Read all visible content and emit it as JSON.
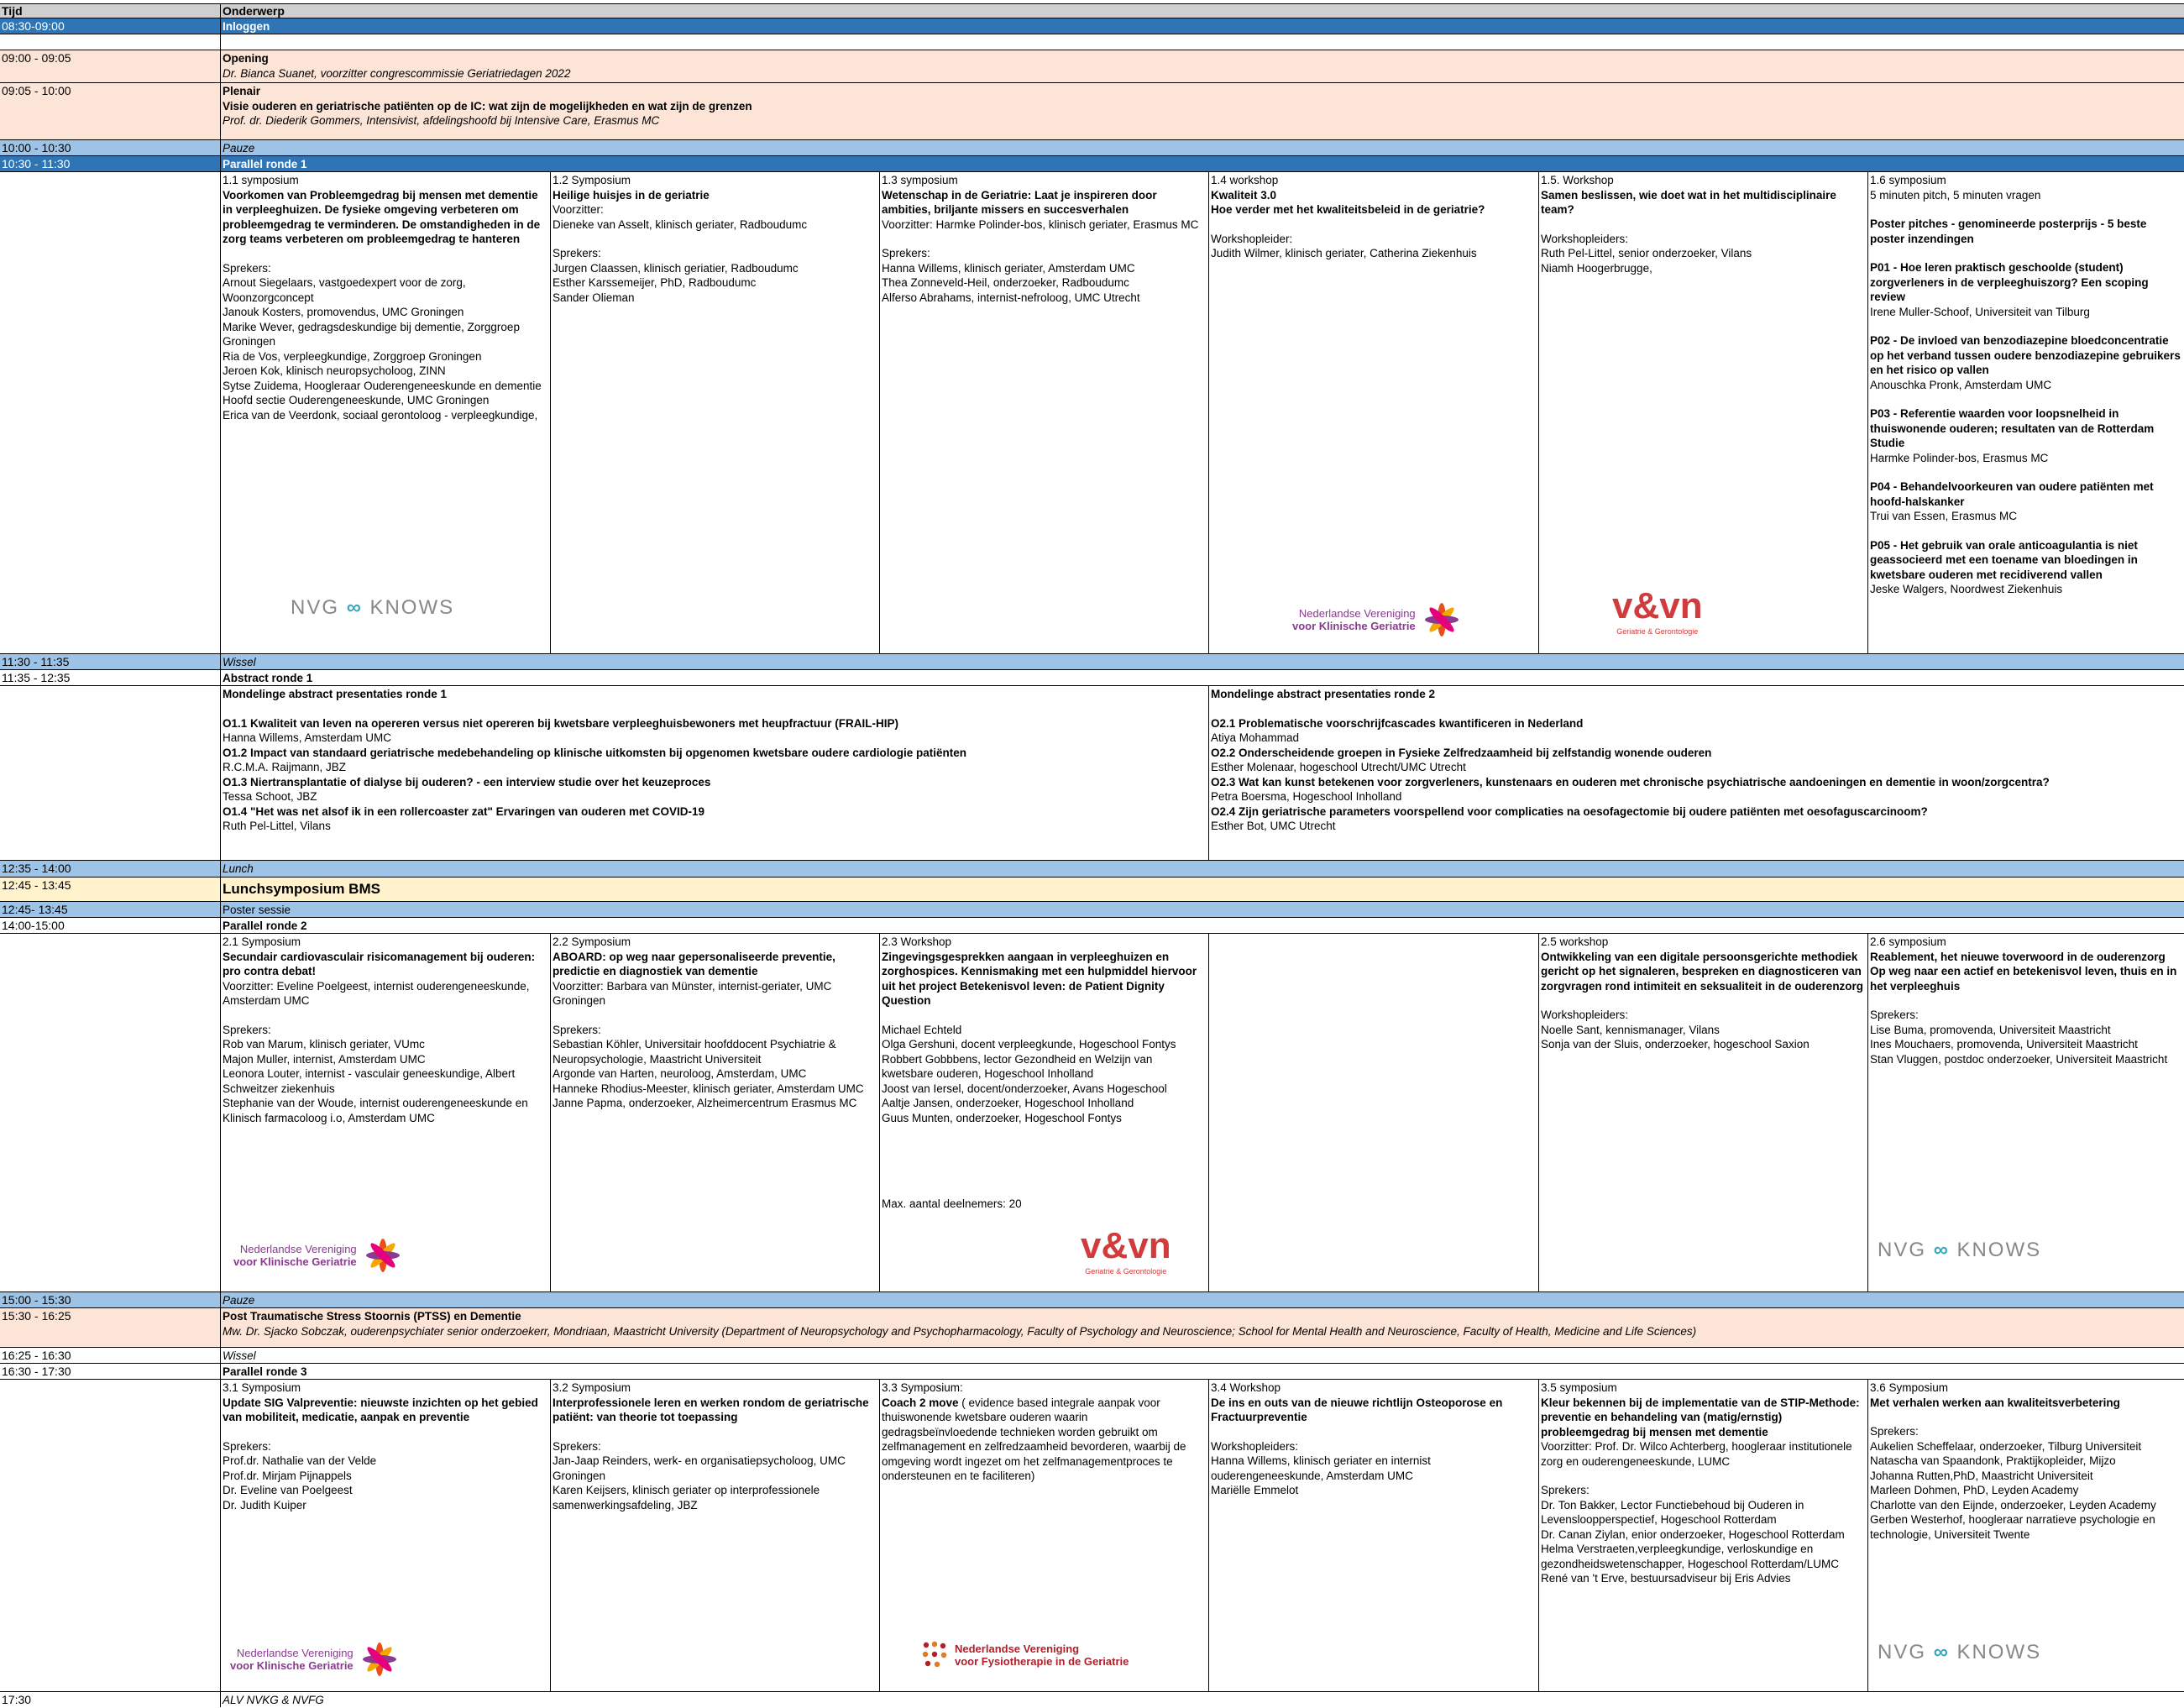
{
  "header": {
    "time": "Tijd",
    "subject": "Onderwerp"
  },
  "rows": {
    "r1": {
      "time": "08:30-09:00",
      "title": "Inloggen"
    },
    "r2": {
      "time": "09:00 - 09:05",
      "title": "Opening",
      "sub": "Dr. Bianca Suanet, voorzitter congrescommissie Geriatriedagen  2022"
    },
    "r3": {
      "time": "09:05 - 10:00",
      "label": "Plenair",
      "title": "Visie ouderen en geriatrische patiënten op de IC: wat zijn de mogelijkheden en wat zijn de grenzen",
      "sub": "Prof. dr. Diederik Gommers, Intensivist, afdelingshoofd bij Intensive Care, Erasmus MC"
    },
    "r4": {
      "time": "10:00 - 10:30",
      "title": "Pauze"
    },
    "r5": {
      "time": "10:30 - 11:30",
      "title": "Parallel ronde 1"
    },
    "r6": {
      "time": "11:30 - 11:35",
      "title": "Wissel"
    },
    "r7": {
      "time": "11:35 - 12:35",
      "title": "Abstract ronde 1"
    },
    "r8": {
      "time": "12:35 - 14:00",
      "title": "Lunch"
    },
    "r9": {
      "time": "12:45 - 13:45",
      "title": "Lunchsymposium BMS"
    },
    "r10": {
      "time": "12:45- 13:45",
      "title": "Poster sessie"
    },
    "r11": {
      "time": "14:00-15:00",
      "title": "Parallel ronde 2"
    },
    "r12": {
      "time": "15:00 - 15:30",
      "title": "Pauze"
    },
    "r13": {
      "time": "15:30 - 16:25",
      "title": "Post Traumatische Stress Stoornis (PTSS) en Dementie",
      "sub": "Mw. Dr. Sjacko Sobczak, ouderenpsychiater senior onderzoekerr, Mondriaan, Maastricht University (Department of Neuropsychology and Psychopharmacology, Faculty of Psychology and Neuroscience; School for Mental Health and Neuroscience, Faculty of Health, Medicine and Life Sciences)"
    },
    "r14": {
      "time": "16:25 - 16:30",
      "title": "Wissel"
    },
    "r15": {
      "time": "16:30 - 17:30",
      "title": "Parallel ronde 3"
    },
    "r16": {
      "time": "17:30",
      "title": "ALV NVKG & NVFG"
    }
  },
  "round1": {
    "s1": {
      "type": "1.1 symposium",
      "title": "Voorkomen van Probleemgedrag bij mensen met dementie in verpleeghuizen. De fysieke omgeving verbeteren om probleemgedrag te verminderen. De omstandigheden in de zorg teams verbeteren om probleemgedrag te hanteren",
      "spk_label": "Sprekers:",
      "people": [
        "Arnout Siegelaars, vastgoedexpert voor de zorg, Woonzorgconcept",
        "Janouk Kosters, promovendus, UMC Groningen",
        "Marike Wever, gedragsdeskundige bij dementie, Zorggroep Groningen",
        "Ria de Vos, verpleegkundige, Zorggroep Groningen",
        "Jeroen Kok, klinisch neuropsycholoog, ZINN",
        "Sytse Zuidema, Hoogleraar Ouderengeneeskunde en dementie Hoofd sectie Ouderengeneeskunde, UMC Groningen",
        "Erica van de Veerdonk, sociaal gerontoloog - verpleegkundige,"
      ],
      "logo": "NVG KNOWS"
    },
    "s2": {
      "type": "1.2 Symposium",
      "title": "Heilige huisjes in de geriatrie",
      "chair_label": "Voorzitter:",
      "chair": "Dieneke van Asselt, klinisch geriater, Radboudumc",
      "spk_label": "Sprekers:",
      "people": [
        "Jurgen Claassen, klinisch geriatier, Radboudumc",
        "Esther Karssemeijer, PhD, Radboudumc",
        "Sander Olieman"
      ]
    },
    "s3": {
      "type": "1.3 symposium",
      "title": "Wetenschap in de Geriatrie: Laat je inspireren door ambities, briljante missers en succesverhalen",
      "chair": "Voorzitter: Harmke Polinder-bos, klinisch geriater, Erasmus MC",
      "spk_label": "Sprekers:",
      "people": [
        "Hanna Willems, klinisch geriater, Amsterdam UMC",
        "Thea Zonneveld-Heil, onderzoeker, Radboudumc",
        "Alferso Abrahams, internist-nefroloog, UMC Utrecht"
      ]
    },
    "s4": {
      "type": "1.4 workshop",
      "title": "Kwaliteit 3.0",
      "title2": "Hoe verder met het kwaliteitsbeleid in de geriatrie?",
      "lead_label": "Workshopleider:",
      "people": [
        "Judith Wilmer, klinisch geriater, Catherina Ziekenhuis"
      ],
      "logo": "Nederlandse Vereniging voor Klinische Geriatrie"
    },
    "s5": {
      "type": "1.5. Workshop",
      "title": "Samen beslissen, wie doet wat in het multidisciplinaire team?",
      "lead_label": "Workshopleiders:",
      "people": [
        "Ruth Pel-Littel, senior onderzoeker, Vilans",
        "Niamh Hoogerbrugge,"
      ],
      "logo": "v&vn",
      "logo_sub": "Geriatrie & Gerontologie"
    },
    "s6": {
      "type": "1.6 symposium",
      "intro": "5 minuten pitch, 5 minuten vragen",
      "title": "Poster pitches - genomineerde posterprijs - 5 beste poster inzendingen",
      "posters": [
        {
          "title": "P01 - Hoe leren praktisch geschoolde (student) zorgverleners in de verpleeghuiszorg? Een scoping review",
          "author": "Irene Muller-Schoof, Universiteit van Tilburg"
        },
        {
          "title": "P02 - De invloed van benzodiazepine bloedconcentratie op het verband tussen oudere benzodiazepine gebruikers en het risico op vallen",
          "author": "Anouschka Pronk, Amsterdam UMC"
        },
        {
          "title": "P03 - Referentie waarden voor loopsnelheid in thuiswonende ouderen;  resultaten van de Rotterdam Studie",
          "author": "Harmke Polinder-bos, Erasmus MC"
        },
        {
          "title": "P04 - Behandelvoorkeuren van oudere patiënten met hoofd-halskanker",
          "author": "Trui van Essen, Erasmus MC"
        },
        {
          "title": "P05 - Het gebruik van orale anticoagulantia is niet geassocieerd met een toename van bloedingen in kwetsbare ouderen met recidiverend vallen",
          "author": "Jeske Walgers, Noordwest Ziekenhuis"
        }
      ]
    }
  },
  "abstract": {
    "left": {
      "title": "Mondelinge abstract presentaties ronde 1",
      "items": [
        {
          "title": "O1.1 Kwaliteit van leven na opereren versus niet opereren bij kwetsbare verpleeghuisbewoners met heupfractuur (FRAIL-HIP)",
          "author": "Hanna Willems, Amsterdam UMC"
        },
        {
          "title": "O1.2 Impact van standaard geriatrische medebehandeling op klinische uitkomsten bij opgenomen kwetsbare oudere cardiologie patiënten",
          "author": "R.C.M.A. Raijmann, JBZ"
        },
        {
          "title": "O1.3 Niertransplantatie of dialyse bij ouderen? - een interview studie over het keuzeproces",
          "author": "Tessa Schoot, JBZ"
        },
        {
          "title": "O1.4 \"Het was net alsof ik in een rollercoaster zat\" Ervaringen van ouderen met COVID-19",
          "author": "Ruth Pel-Littel, Vilans"
        }
      ]
    },
    "right": {
      "title": "Mondelinge abstract presentaties ronde 2",
      "items": [
        {
          "title": "O2.1 Problematische voorschrijfcascades kwantificeren in Nederland",
          "author": "Atiya Mohammad"
        },
        {
          "title": "O2.2 Onderscheidende groepen in Fysieke Zelfredzaamheid bij zelfstandig wonende ouderen",
          "author": "Esther Molenaar, hogeschool Utrecht/UMC Utrecht"
        },
        {
          "title": "O2.3 Wat kan kunst betekenen voor zorgverleners, kunstenaars en ouderen met chronische psychiatrische aandoeningen en dementie in woon/zorgcentra?",
          "author": "Petra Boersma, Hogeschool Inholland"
        },
        {
          "title": "O2.4 Zijn geriatrische parameters voorspellend voor complicaties na oesofagectomie bij oudere patiënten met oesofaguscarcinoom?",
          "author": "Esther Bot, UMC Utrecht"
        }
      ]
    }
  },
  "round2": {
    "s1": {
      "type": "2.1  Symposium",
      "title": "Secundair cardiovasculair risicomanagement bij ouderen: pro contra debat!",
      "chair": "Voorzitter: Eveline Poelgeest, internist ouderengeneeskunde, Amsterdam UMC",
      "spk_label": "Sprekers:",
      "people": [
        "Rob van Marum, klinisch geriater, VUmc",
        "Majon Muller, internist, Amsterdam UMC",
        "Leonora Louter, internist - vasculair geneeskundige, Albert Schweitzer ziekenhuis",
        "Stephanie van der Woude, internist ouderengeneeskunde en Klinisch farmacoloog i.o, Amsterdam UMC"
      ],
      "logo": "Nederlandse Vereniging voor Klinische Geriatrie"
    },
    "s2": {
      "type": "2.2 Symposium",
      "title": "ABOARD: op weg naar gepersonaliseerde preventie, predictie en diagnostiek van dementie",
      "chair": "Voorzitter: Barbara van Münster, internist-geriater, UMC Groningen",
      "spk_label": "Sprekers:",
      "people": [
        "Sebastian Köhler, Universitair hoofddocent Psychiatrie & Neuropsychologie, Maastricht Universiteit",
        "Argonde van Harten, neuroloog, Amsterdam, UMC",
        "Hanneke Rhodius-Meester, klinisch geriater, Amsterdam UMC",
        "Janne Papma, onderzoeker, Alzheimercentrum Erasmus MC"
      ]
    },
    "s3": {
      "type": "2.3 Workshop",
      "title": "Zingevingsgesprekken aangaan in verpleeghuizen en zorghospices. Kennismaking met een hulpmiddel hiervoor uit het project Betekenisvol leven: de Patient Dignity Question",
      "people": [
        "Michael  Echteld",
        "Olga Gershuni, docent verpleegkunde, Hogeschool Fontys",
        "Robbert Gobbbens, lector Gezondheid en Welzijn van kwetsbare ouderen, Hogeschool Inholland",
        "Joost van Iersel, docent/onderzoeker, Avans Hogeschool",
        "Aaltje Jansen, onderzoeker, Hogeschool Inholland",
        "Guus Munten, onderzoeker, Hogeschool Fontys"
      ],
      "max": "Max. aantal deelnemers: 20",
      "logo": "v&vn",
      "logo_sub": "Geriatrie & Gerontologie"
    },
    "s5": {
      "type": "2.5 workshop",
      "title": "Ontwikkeling van een digitale persoonsgerichte methodiek gericht op het signaleren, bespreken en diagnosticeren van zorgvragen rond intimiteit en seksualiteit in de ouderenzorg",
      "lead_label": "Workshopleiders:",
      "people": [
        "Noelle Sant, kennismanager, Vilans",
        "Sonja van der Sluis, onderzoeker, hogeschool Saxion"
      ]
    },
    "s6": {
      "type": "2.6 symposium",
      "title": "Reablement, het nieuwe toverwoord in de ouderenzorg Op weg naar een actief en betekenisvol leven, thuis en in het verpleeghuis",
      "spk_label": "Sprekers:",
      "people": [
        "Lise Buma, promovenda, Universiteit Maastricht",
        "Ines  Mouchaers, promovenda, Universiteit Maastricht",
        "Stan Vluggen, postdoc onderzoeker, Universiteit Maastricht"
      ],
      "logo": "NVG KNOWS"
    }
  },
  "round3": {
    "s1": {
      "type": "3.1 Symposium",
      "title": "Update SIG Valpreventie: nieuwste inzichten op het gebied van mobiliteit, medicatie, aanpak en preventie",
      "spk_label": "Sprekers:",
      "people": [
        "Prof.dr. Nathalie van der Velde",
        "Prof.dr. Mirjam Pijnappels",
        "Dr. Eveline van Poelgeest",
        "Dr. Judith Kuiper"
      ],
      "logo": "Nederlandse Vereniging voor Klinische Geriatrie"
    },
    "s2": {
      "type": "3.2 Symposium",
      "title": "Interprofessionele leren en werken rondom de geriatrische patiënt: van theorie tot toepassing",
      "spk_label": "Sprekers:",
      "people": [
        "Jan-Jaap Reinders, werk- en organisatiepsycholoog, UMC Groningen",
        "Karen Keijsers, klinisch geriater op interprofessionele samenwerkingsafdeling, JBZ"
      ]
    },
    "s3": {
      "type": "3.3 Symposium:",
      "title": "Coach 2 move",
      "desc": " ( evidence based  integrale aanpak voor thuiswonende kwetsbare ouderen waarin gedragsbeïnvloedende technieken worden gebruikt om zelfmanagement en zelfredzaamheid bevorderen, waarbij de omgeving wordt ingezet om het zelfmanagementproces te ondersteunen en te faciliteren)",
      "logo": "Nederlandse Vereniging voor Fysiotherapie in de Geriatrie"
    },
    "s4": {
      "type": "3.4 Workshop",
      "title": "De ins en outs van de nieuwe richtlijn Osteoporose en Fractuurpreventie",
      "lead_label": "Workshopleiders:",
      "people": [
        "Hanna Willems, klinisch geriater en internist ouderengeneeskunde, Amsterdam UMC",
        "Mariëlle Emmelot"
      ]
    },
    "s5": {
      "type": "3.5  symposium",
      "title": "Kleur bekennen bij de implementatie van de STIP-Methode: preventie en behandeling van (matig/ernstig) probleemgedrag bij mensen met dementie",
      "chair": "Voorzitter: Prof. Dr. Wilco Achterberg, hoogleraar institutionele zorg en ouderengeneeskunde, LUMC",
      "spk_label": "Sprekers:",
      "people": [
        "Dr. Ton Bakker, Lector Functiebehoud bij Ouderen in Levensloopperspectief, Hogeschool Rotterdam",
        "Dr. Canan Ziylan, enior onderzoeker, Hogeschool Rotterdam",
        "Helma Verstraeten,verpleegkundige, verloskundige en gezondheidswetenschapper, Hogeschool Rotterdam/LUMC",
        "René van 't Erve, bestuursadviseur bij Eris Advies"
      ]
    },
    "s6": {
      "type": "3.6 Symposium",
      "title": "Met verhalen werken aan kwaliteitsverbetering",
      "spk_label": "Sprekers:",
      "people": [
        "Aukelien Scheffelaar, onderzoeker, Tilburg Universiteit",
        "Natascha van Spaandonk, Praktijkopleider, Mijzo",
        "Johanna Rutten,PhD, Maastricht Universiteit",
        "Marleen Dohmen, PhD, Leyden Academy",
        "Charlotte van den Eijnde,  onderzoeker, Leyden Academy",
        "Gerben Westerhof, hoogleraar narratieve psychologie en technologie, Universiteit Twente"
      ],
      "logo": "NVG KNOWS"
    }
  },
  "colors": {
    "dark_blue": "#2f75b5",
    "light_blue": "#9dc3e6",
    "peach": "#fce4d6",
    "header_grey": "#d0cece",
    "lunch_yellow": "#fff2cc"
  }
}
